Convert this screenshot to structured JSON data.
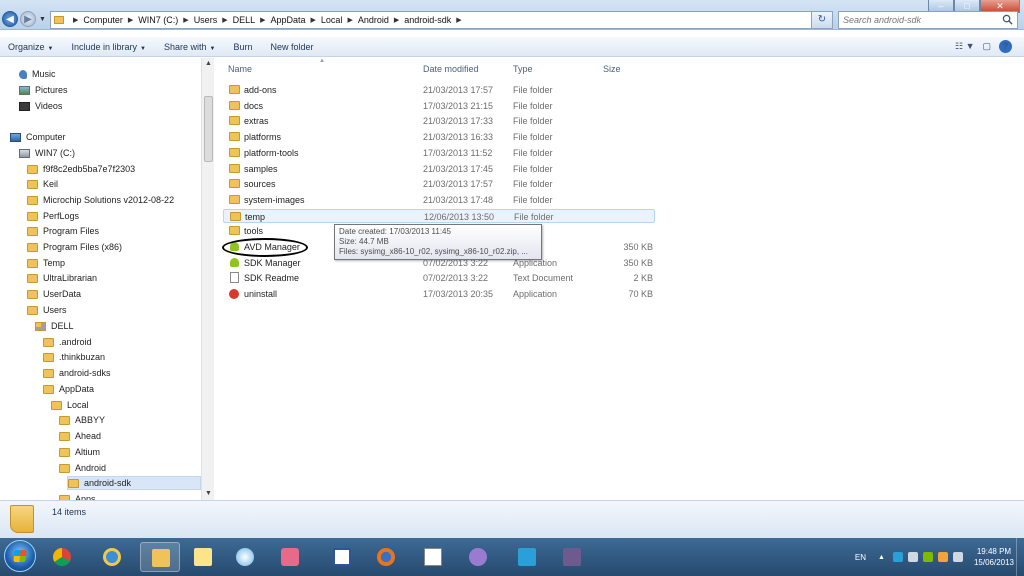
{
  "window": {
    "controls": [
      "–",
      "□",
      "✕"
    ]
  },
  "address": {
    "crumbs": [
      "Computer",
      "WIN7 (C:)",
      "Users",
      "DELL",
      "AppData",
      "Local",
      "Android",
      "android-sdk"
    ]
  },
  "search": {
    "placeholder": "Search android-sdk"
  },
  "toolbar": {
    "organize": "Organize",
    "include_in_library": "Include in library",
    "share_with": "Share with",
    "burn": "Burn",
    "new_folder": "New folder"
  },
  "nav_pane": {
    "items": [
      {
        "label": "Music",
        "icon": "music-icon"
      },
      {
        "label": "Pictures",
        "icon": "pictures-icon"
      },
      {
        "label": "Videos",
        "icon": "videos-icon"
      },
      {
        "label": "Computer",
        "icon": "computer-icon"
      },
      {
        "label": "WIN7 (C:)",
        "icon": "drive-icon"
      },
      {
        "label": "f9f8c2edb5ba7e7f2303",
        "icon": "folder-icon"
      },
      {
        "label": "Keil",
        "icon": "folder-icon"
      },
      {
        "label": "Microchip Solutions v2012-08-22",
        "icon": "folder-icon"
      },
      {
        "label": "PerfLogs",
        "icon": "folder-icon"
      },
      {
        "label": "Program Files",
        "icon": "folder-icon"
      },
      {
        "label": "Program Files (x86)",
        "icon": "folder-icon"
      },
      {
        "label": "Temp",
        "icon": "folder-icon"
      },
      {
        "label": "UltraLibrarian",
        "icon": "folder-icon"
      },
      {
        "label": "UserData",
        "icon": "folder-icon"
      },
      {
        "label": "Users",
        "icon": "folder-icon"
      },
      {
        "label": "DELL",
        "icon": "user-folder-icon"
      },
      {
        "label": ".android",
        "icon": "folder-icon"
      },
      {
        "label": ".thinkbuzan",
        "icon": "folder-icon"
      },
      {
        "label": "android-sdks",
        "icon": "folder-icon"
      },
      {
        "label": "AppData",
        "icon": "folder-icon"
      },
      {
        "label": "Local",
        "icon": "folder-icon"
      },
      {
        "label": "ABBYY",
        "icon": "folder-icon"
      },
      {
        "label": "Ahead",
        "icon": "folder-icon"
      },
      {
        "label": "Altium",
        "icon": "folder-icon"
      },
      {
        "label": "Android",
        "icon": "folder-icon"
      },
      {
        "label": "android-sdk",
        "icon": "folder-icon",
        "selected": true
      },
      {
        "label": "Apps",
        "icon": "folder-icon"
      }
    ]
  },
  "columns": {
    "name": "Name",
    "date_modified": "Date modified",
    "type": "Type",
    "size": "Size"
  },
  "files": [
    {
      "name": "add-ons",
      "date": "21/03/2013 17:57",
      "type": "File folder",
      "size": "",
      "icon": "folder-icon"
    },
    {
      "name": "docs",
      "date": "17/03/2013 21:15",
      "type": "File folder",
      "size": "",
      "icon": "folder-icon"
    },
    {
      "name": "extras",
      "date": "21/03/2013 17:33",
      "type": "File folder",
      "size": "",
      "icon": "folder-icon"
    },
    {
      "name": "platforms",
      "date": "21/03/2013 16:33",
      "type": "File folder",
      "size": "",
      "icon": "folder-icon"
    },
    {
      "name": "platform-tools",
      "date": "17/03/2013 11:52",
      "type": "File folder",
      "size": "",
      "icon": "folder-icon"
    },
    {
      "name": "samples",
      "date": "21/03/2013 17:45",
      "type": "File folder",
      "size": "",
      "icon": "folder-icon"
    },
    {
      "name": "sources",
      "date": "21/03/2013 17:57",
      "type": "File folder",
      "size": "",
      "icon": "folder-icon"
    },
    {
      "name": "system-images",
      "date": "21/03/2013 17:48",
      "type": "File folder",
      "size": "",
      "icon": "folder-icon"
    },
    {
      "name": "temp",
      "date": "12/06/2013 13:50",
      "type": "File folder",
      "size": "",
      "icon": "folder-icon",
      "hover": true
    },
    {
      "name": "tools",
      "date": "",
      "type": "der",
      "size": "",
      "icon": "folder-icon"
    },
    {
      "name": "AVD Manager",
      "date": "",
      "type": "tion",
      "size": "350 KB",
      "icon": "android-icon"
    },
    {
      "name": "SDK Manager",
      "date": "07/02/2013 3:22",
      "type": "Application",
      "size": "350 KB",
      "icon": "android-icon"
    },
    {
      "name": "SDK Readme",
      "date": "07/02/2013 3:22",
      "type": "Text Document",
      "size": "2 KB",
      "icon": "text-document-icon"
    },
    {
      "name": "uninstall",
      "date": "17/03/2013 20:35",
      "type": "Application",
      "size": "70 KB",
      "icon": "uninstall-icon"
    }
  ],
  "tooltip": {
    "line1": "Date created: 17/03/2013 11:45",
    "line2": "Size: 44.7 MB",
    "line3": "Files: sysimg_x86-10_r02, sysimg_x86-10_r02.zip, ..."
  },
  "details": {
    "item_count": "14 items"
  },
  "taskbar": {
    "apps": [
      "start-orb-icon",
      "chrome-icon",
      "internet-explorer-icon",
      "windows-explorer-icon",
      "notes-icon",
      "paint-icon",
      "camera-icon",
      "word-icon",
      "firefox-icon",
      "notepad-icon",
      "messenger-icon",
      "3g-modem-icon",
      "board-icon"
    ],
    "tray_lang": "EN",
    "tray_arrow": "▲",
    "time": "19:48 PM",
    "date": "15/06/2013"
  },
  "colors": {
    "accent": "#3d6a95",
    "selection": "#d8e6f7",
    "hover": "#eaf3fc"
  }
}
